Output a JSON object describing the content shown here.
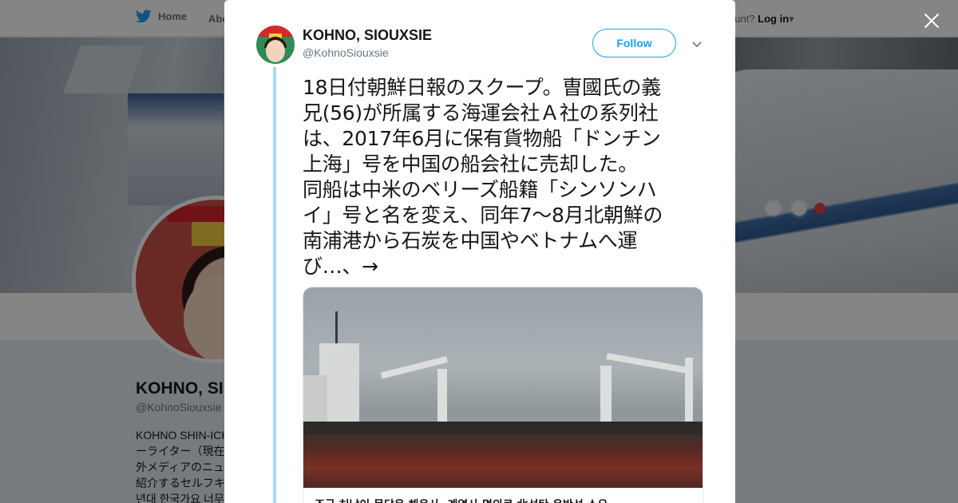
{
  "nav": {
    "home_label": "Home",
    "about_label": "Abo",
    "account_prompt": "ccount?",
    "login_label": "Log in"
  },
  "profile_bg": {
    "name": "KOHNO, SI",
    "handle": "@KohnoSiouxsie",
    "bio_lines": [
      "KOHNO SHIN-ICH",
      "ーライター（現在",
      "外メディアのニュ",
      "紹介するセルフキ",
      "년대 한국가요 너무"
    ]
  },
  "tweet": {
    "author_name": "KOHNO, SIOUXSIE",
    "author_handle": "@KohnoSiouxsie",
    "follow_label": "Follow",
    "text_lines": [
      "18日付朝鮮日報のスクープ。曺國氏の義",
      "兄(56)が所属する海運会社Ａ社の系列社",
      "は、2017年6月に保有貨物船「ドンチン",
      "上海」号を中国の船会社に売却した。",
      "同船は中米のベリーズ船籍「シンソンハ",
      "イ」号と名を変え、同年7〜8月北朝鮮の",
      "南浦港から石炭を中国やベトナムへ運",
      "び…、→"
    ],
    "card_title": "조국 처남이 몸담은 해운사, 계열사 명의로 北석탄 운반선 소유"
  },
  "colors": {
    "twitter_blue": "#1da1f2",
    "thread_line": "#a4d9f9",
    "overlay": "rgba(0,0,0,0.48)"
  },
  "icons": {
    "nav_home": "twitter-bird-icon",
    "close": "close-icon",
    "caret": "chevron-down-icon"
  }
}
